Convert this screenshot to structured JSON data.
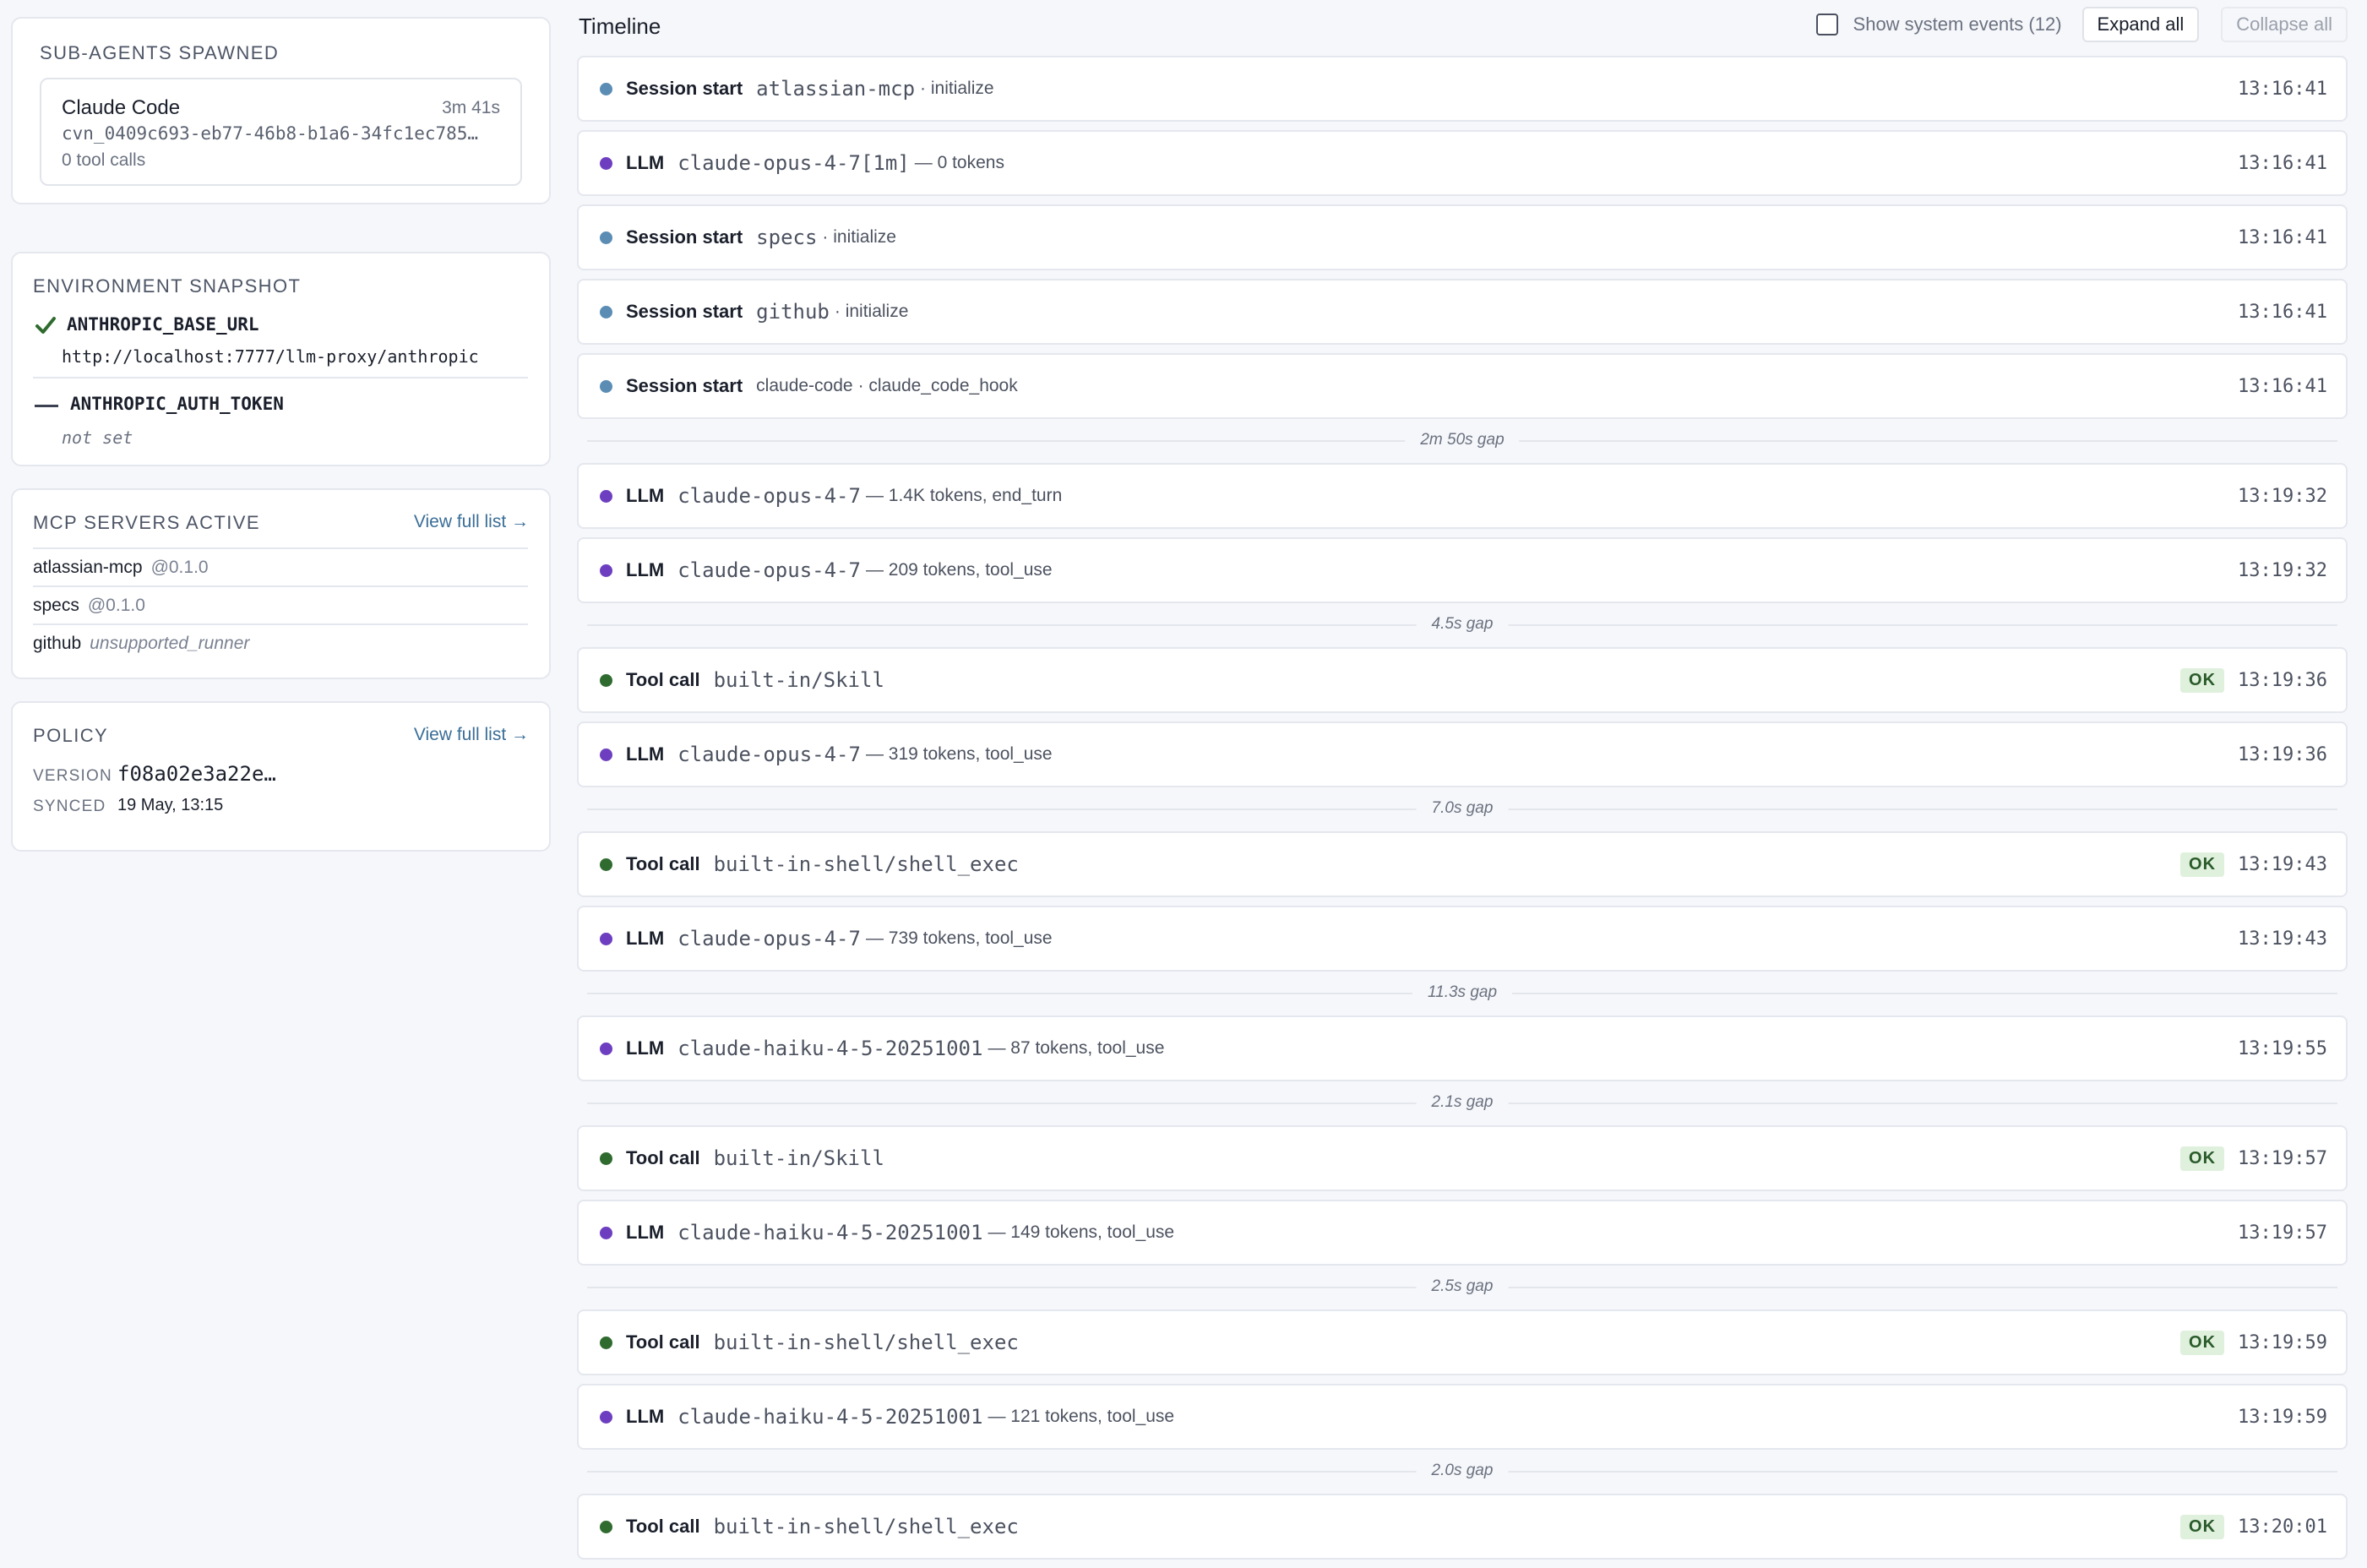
{
  "subagents": {
    "title": "SUB-AGENTS SPAWNED",
    "agent": {
      "name": "Claude Code",
      "duration": "3m 41s",
      "id": "cvn_0409c693-eb77-46b8-b1a6-34fc1ec785…",
      "calls": "0 tool calls"
    }
  },
  "env": {
    "title": "ENVIRONMENT SNAPSHOT",
    "vars": [
      {
        "key": "ANTHROPIC_BASE_URL",
        "value": "http://localhost:7777/llm-proxy/anthropic",
        "status_icon": "check-icon"
      },
      {
        "key": "ANTHROPIC_AUTH_TOKEN",
        "value": "not set",
        "status_icon": "dash-icon"
      }
    ]
  },
  "mcp": {
    "title": "MCP SERVERS ACTIVE",
    "link": "View full list →",
    "servers": [
      {
        "name": "atlassian-mcp",
        "version": "@0.1.0"
      },
      {
        "name": "specs",
        "version": "@0.1.0"
      },
      {
        "name": "github",
        "version": "unsupported_runner"
      }
    ]
  },
  "policy": {
    "title": "POLICY",
    "link": "View full list →",
    "version_label": "VERSION",
    "version": "f08a02e3a22e…",
    "synced_label": "SYNCED",
    "synced": "19 May, 13:15"
  },
  "timeline": {
    "title": "Timeline",
    "show_system_label": "Show system events (12)",
    "expand_label": "Expand all",
    "collapse_label": "Collapse all",
    "colors": {
      "session": "#5b8db4",
      "llm": "#6d3fc0",
      "tool": "#2f6b2f"
    },
    "items": [
      {
        "type": "event",
        "kind": "Session start",
        "cat": "session",
        "target": "atlassian-mcp",
        "detail": "· initialize",
        "time": "13:16:41"
      },
      {
        "type": "event",
        "kind": "LLM",
        "cat": "llm",
        "target": "claude-opus-4-7[1m]",
        "detail": "— 0 tokens",
        "time": "13:16:41"
      },
      {
        "type": "event",
        "kind": "Session start",
        "cat": "session",
        "target": "specs",
        "detail": "· initialize",
        "time": "13:16:41"
      },
      {
        "type": "event",
        "kind": "Session start",
        "cat": "session",
        "target": "github",
        "detail": "· initialize",
        "time": "13:16:41"
      },
      {
        "type": "event",
        "kind": "Session start",
        "cat": "session",
        "target": "claude-code",
        "plain": true,
        "detail": "· claude_code_hook",
        "time": "13:16:41"
      },
      {
        "type": "gap",
        "label": "2m 50s gap"
      },
      {
        "type": "event",
        "kind": "LLM",
        "cat": "llm",
        "target": "claude-opus-4-7",
        "detail": "— 1.4K tokens, end_turn",
        "time": "13:19:32"
      },
      {
        "type": "event",
        "kind": "LLM",
        "cat": "llm",
        "target": "claude-opus-4-7",
        "detail": "— 209 tokens, tool_use",
        "time": "13:19:32"
      },
      {
        "type": "gap",
        "label": "4.5s gap"
      },
      {
        "type": "event",
        "kind": "Tool call",
        "cat": "tool",
        "target": "built-in/Skill",
        "detail": "",
        "status": "OK",
        "time": "13:19:36"
      },
      {
        "type": "event",
        "kind": "LLM",
        "cat": "llm",
        "target": "claude-opus-4-7",
        "detail": "— 319 tokens, tool_use",
        "time": "13:19:36"
      },
      {
        "type": "gap",
        "label": "7.0s gap"
      },
      {
        "type": "event",
        "kind": "Tool call",
        "cat": "tool",
        "target": "built-in-shell/shell_exec",
        "detail": "",
        "status": "OK",
        "time": "13:19:43"
      },
      {
        "type": "event",
        "kind": "LLM",
        "cat": "llm",
        "target": "claude-opus-4-7",
        "detail": "— 739 tokens, tool_use",
        "time": "13:19:43"
      },
      {
        "type": "gap",
        "label": "11.3s gap"
      },
      {
        "type": "event",
        "kind": "LLM",
        "cat": "llm",
        "target": "claude-haiku-4-5-20251001",
        "detail": "— 87 tokens, tool_use",
        "time": "13:19:55"
      },
      {
        "type": "gap",
        "label": "2.1s gap"
      },
      {
        "type": "event",
        "kind": "Tool call",
        "cat": "tool",
        "target": "built-in/Skill",
        "detail": "",
        "status": "OK",
        "time": "13:19:57"
      },
      {
        "type": "event",
        "kind": "LLM",
        "cat": "llm",
        "target": "claude-haiku-4-5-20251001",
        "detail": "— 149 tokens, tool_use",
        "time": "13:19:57"
      },
      {
        "type": "gap",
        "label": "2.5s gap"
      },
      {
        "type": "event",
        "kind": "Tool call",
        "cat": "tool",
        "target": "built-in-shell/shell_exec",
        "detail": "",
        "status": "OK",
        "time": "13:19:59"
      },
      {
        "type": "event",
        "kind": "LLM",
        "cat": "llm",
        "target": "claude-haiku-4-5-20251001",
        "detail": "— 121 tokens, tool_use",
        "time": "13:19:59"
      },
      {
        "type": "gap",
        "label": "2.0s gap"
      },
      {
        "type": "event",
        "kind": "Tool call",
        "cat": "tool",
        "target": "built-in-shell/shell_exec",
        "detail": "",
        "status": "OK",
        "time": "13:20:01"
      }
    ]
  }
}
